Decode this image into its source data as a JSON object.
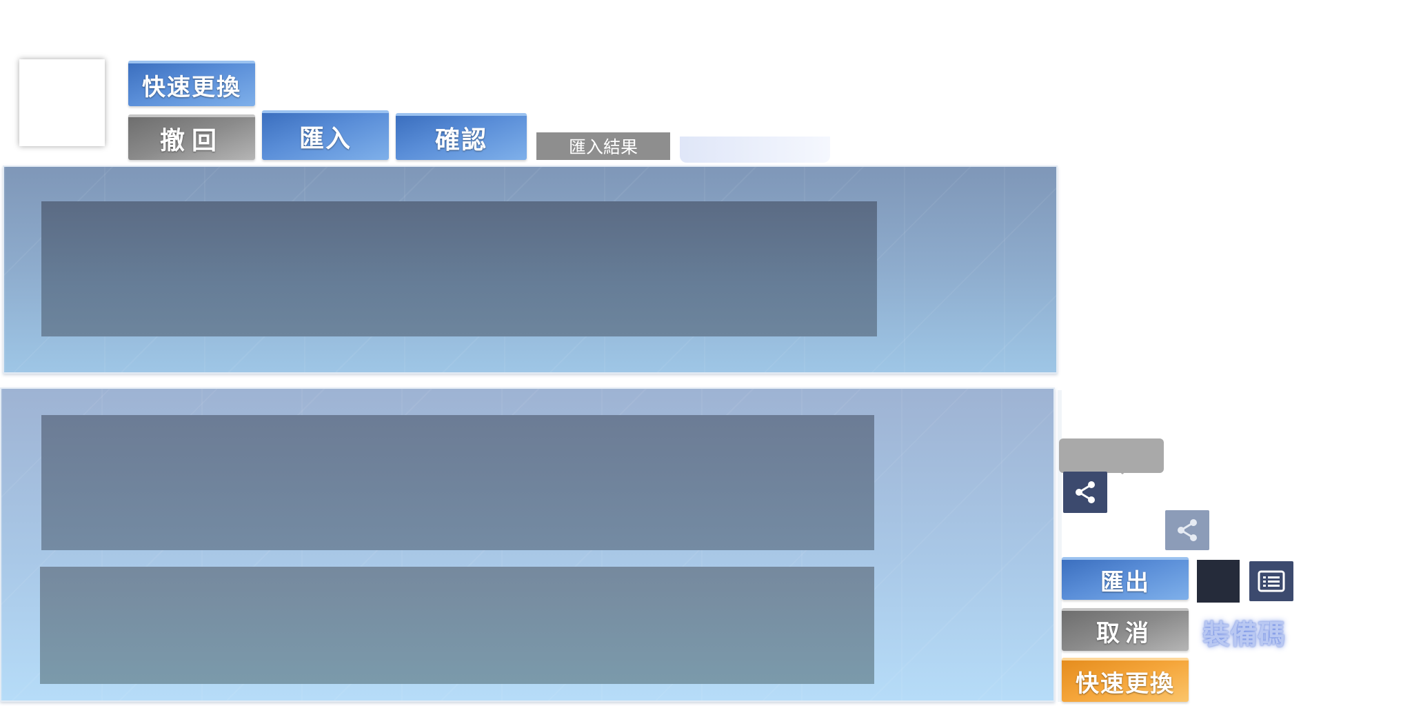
{
  "toolbar": {
    "quick_swap_label": "快速更換",
    "undo_label": "撤回",
    "import_label": "匯入",
    "confirm_label": "確認",
    "import_result_label": "匯入結果"
  },
  "side_panel": {
    "export_label": "匯出",
    "cancel_label": "取消",
    "quick_swap_label": "快速更換",
    "equipment_code_label": "裝備碼"
  },
  "icons": {
    "share_primary": "share-icon",
    "share_secondary": "share-icon",
    "list": "list-icon"
  },
  "colors": {
    "button_blue": "#4a7fcf",
    "button_gray": "#8a8a8a",
    "button_orange": "#f3a23a",
    "panel_top": "#8eaccd",
    "panel_bottom": "#a9c8e7",
    "dark_icon_bg": "#3c4a6e",
    "equipment_code_text": "#b9c8f2"
  }
}
